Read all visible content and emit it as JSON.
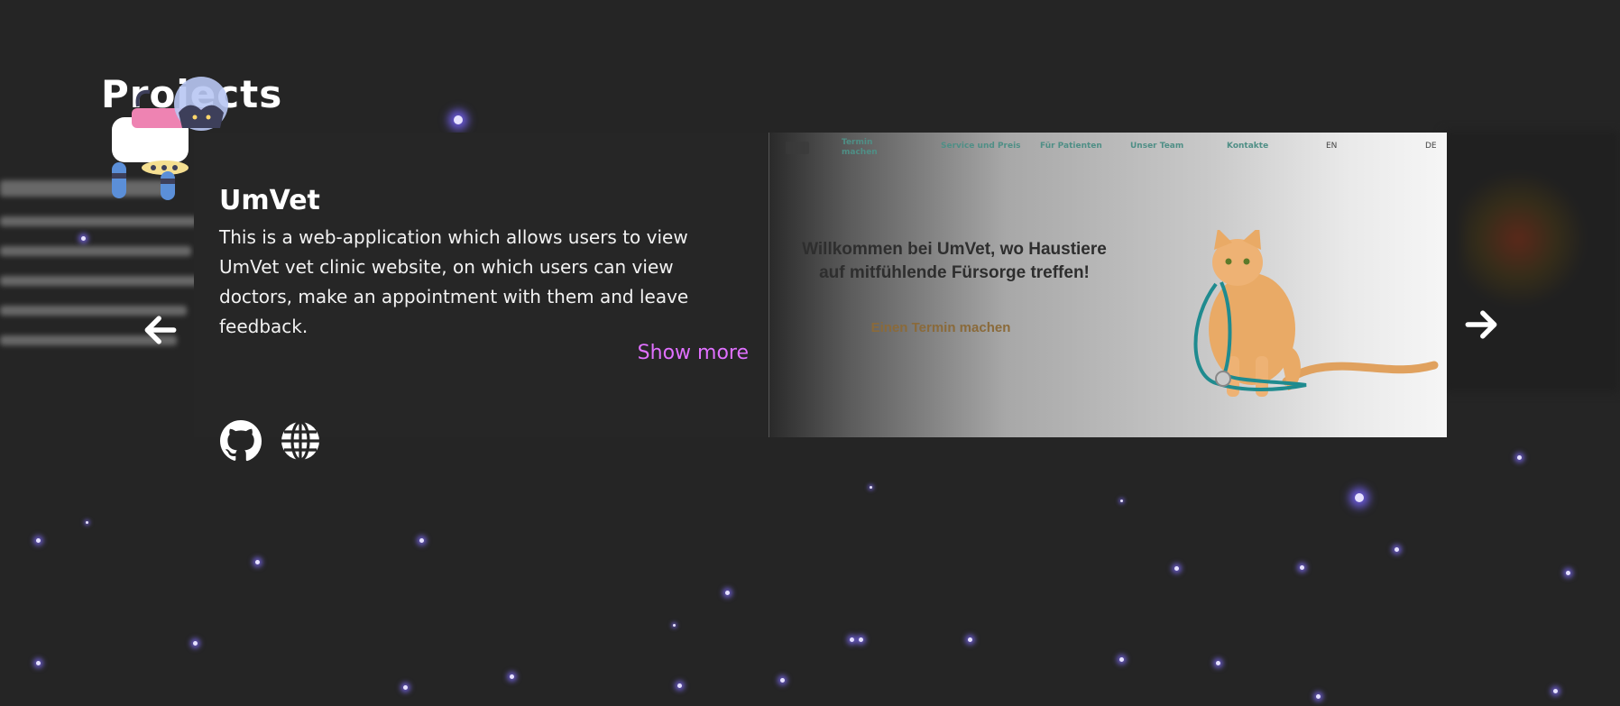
{
  "section": {
    "title": "Projects"
  },
  "project": {
    "title": "UmVet",
    "description": "This is a web-application which allows users to view UmVet vet clinic website, on which users can view doctors, make an appointment with them and leave feedback.",
    "show_more": "Show more",
    "links": [
      {
        "icon": "github-icon"
      },
      {
        "icon": "globe-icon"
      }
    ],
    "screenshot": {
      "nav": [
        "Termin machen",
        "Service und Preis",
        "Für Patienten",
        "Unser Team",
        "Kontakte"
      ],
      "lang_en": "EN",
      "lang_de": "DE",
      "heading": "Willkommen bei UmVet, wo Haustiere auf mitfühlende Fürsorge treffen!",
      "cta": "Einen Termin machen"
    }
  },
  "navigation": {
    "prev_icon": "arrow-left-icon",
    "next_icon": "arrow-right-icon"
  },
  "colors": {
    "background": "#252525",
    "accent": "#e070ff",
    "star_glow": "#7a64ff"
  }
}
